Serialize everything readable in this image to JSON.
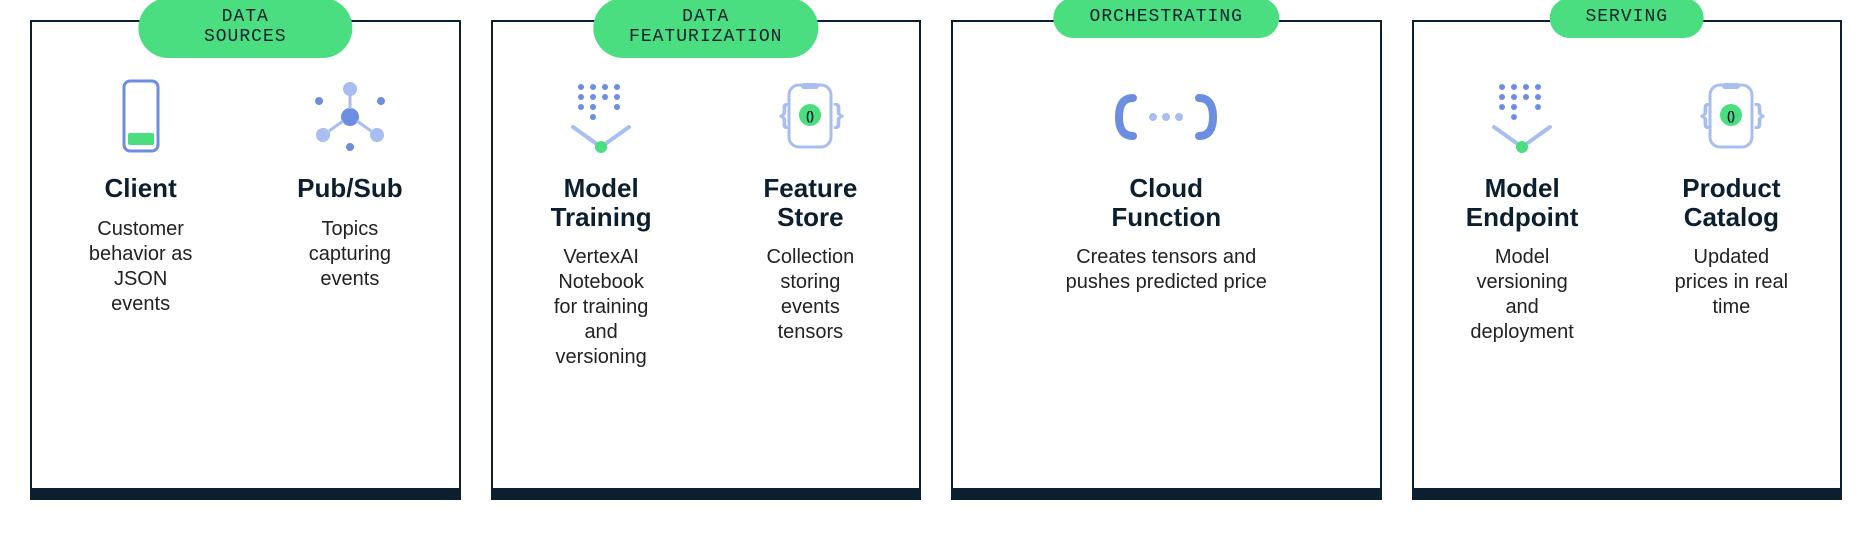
{
  "stages": [
    {
      "label": "DATA SOURCES",
      "items": [
        {
          "icon": "client-icon",
          "title": "Client",
          "desc": "Customer\nbehavior as\nJSON\nevents"
        },
        {
          "icon": "pubsub-icon",
          "title": "Pub/Sub",
          "desc": "Topics\ncapturing\nevents"
        }
      ]
    },
    {
      "label": "DATA\nFEATURIZATION",
      "items": [
        {
          "icon": "model-training-icon",
          "title": "Model\nTraining",
          "desc": "VertexAI\nNotebook\nfor training\nand\nversioning"
        },
        {
          "icon": "feature-store-icon",
          "title": "Feature\nStore",
          "desc": "Collection\nstoring\nevents\ntensors"
        }
      ]
    },
    {
      "label": "ORCHESTRATING",
      "items": [
        {
          "icon": "cloud-function-icon",
          "title": "Cloud\nFunction",
          "desc": "Creates tensors and\npushes predicted price"
        }
      ]
    },
    {
      "label": "SERVING",
      "items": [
        {
          "icon": "model-endpoint-icon",
          "title": "Model\nEndpoint",
          "desc": "Model\nversioning\nand\ndeployment"
        },
        {
          "icon": "product-catalog-icon",
          "title": "Product\nCatalog",
          "desc": "Updated\nprices in real\ntime"
        }
      ]
    }
  ],
  "colors": {
    "accent": "#4ade80",
    "ink": "#0b1f2f",
    "iconBlue": "#6c8ee0"
  }
}
